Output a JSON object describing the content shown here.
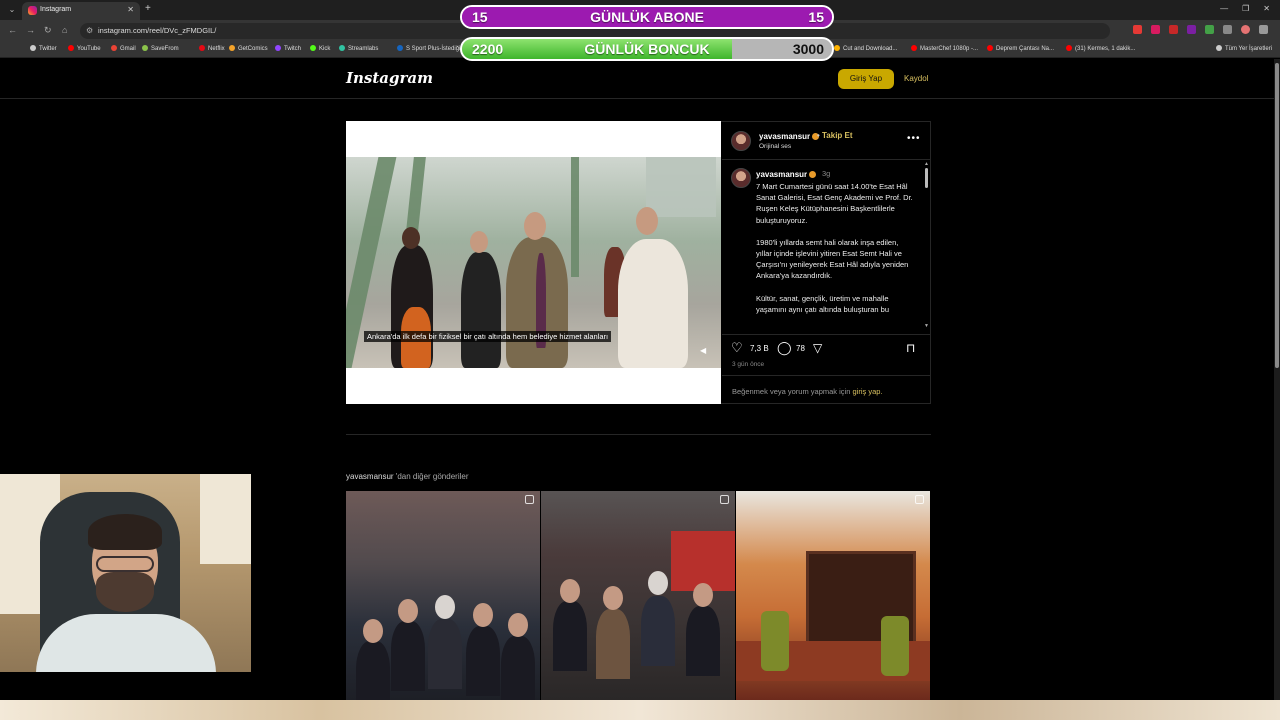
{
  "browser": {
    "tab_title": "Instagram",
    "url": "instagram.com/reel/DVc_zFMDGIL/",
    "bookmarks": [
      "Twitter",
      "YouTube",
      "Gmail",
      "SaveFrom",
      "Netflix",
      "GetComics",
      "Twitch",
      "Kick",
      "Streamlabs",
      "S Sport Plus-İstediği...",
      "Home",
      "GeoGuessr",
      "Cut and Download...",
      "MasterChef 1080p -...",
      "Deprem Çantası Na...",
      "(31) Kermes, 1 dakik...",
      "Tüm Yer İşaretleri"
    ],
    "bookmark_colors": [
      "#cccccc",
      "#ff0000",
      "#ea4335",
      "#8bc34a",
      "#e50914",
      "#f4a32a",
      "#9146ff",
      "#53fc18",
      "#31c3a2",
      "#1565c0",
      "#4285f4",
      "#ff7043",
      "#ffb300",
      "#ff0000",
      "#ff0000",
      "#ff0000",
      "#cccccc"
    ]
  },
  "overlay": {
    "goal1": {
      "left": "15",
      "label": "GÜNLÜK ABONE",
      "right": "15",
      "progress": 1.0
    },
    "goal2": {
      "left": "2200",
      "label": "GÜNLÜK BONCUK",
      "right": "3000",
      "progress": 0.73
    }
  },
  "header": {
    "logo": "Instagram",
    "login": "Giriş Yap",
    "signup": "Kaydol"
  },
  "post": {
    "username": "yavasmansur",
    "follow": "Takip Et",
    "follow_separator": "•",
    "audio": "Orijinal ses",
    "caption_time": "3g",
    "caption": [
      "7 Mart Cumartesi günü saat 14.00'te Esat Hâl Sanat Galerisi, Esat Genç Akademi ve Prof. Dr. Ruşen Keleş Kütüphanesini Başkentlilerle buluşturuyoruz.",
      "1980'li yıllarda semt hali olarak inşa edilen, yıllar içinde işlevini yitiren Esat Semt Hali ve Çarşısı'nı yenileyerek Esat Hâl adıyla yeniden Ankara'ya kazandırdık.",
      "Kültür, sanat, gençlik, üretim ve mahalle yaşamını aynı çatı altında buluşturan bu"
    ],
    "subtitle": "Ankara'da ilk defa bir fiziksel bir çatı altında hem belediye hizmet alanları",
    "likes": "7,3 B",
    "comments": "78",
    "time": "3 gün önce",
    "login_prompt": "Beğenmek veya yorum yapmak için",
    "login_link": "giriş yap."
  },
  "more_posts": {
    "user": "yavasmansur",
    "suffix": " 'dan diğer gönderiler"
  }
}
